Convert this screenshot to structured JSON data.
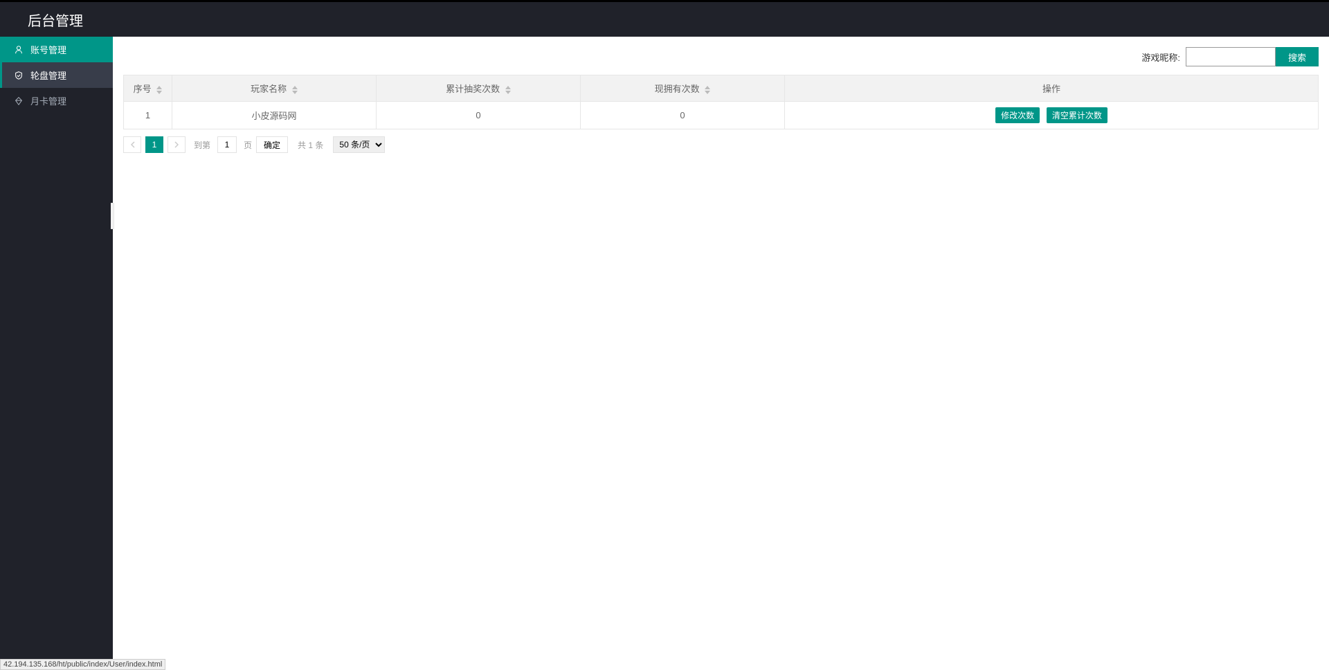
{
  "header": {
    "title": "后台管理"
  },
  "sidebar": {
    "items": [
      {
        "label": "账号管理",
        "icon": "user"
      },
      {
        "label": "轮盘管理",
        "icon": "shield"
      },
      {
        "label": "月卡管理",
        "icon": "diamond"
      }
    ]
  },
  "search": {
    "label": "游戏昵称:",
    "value": "",
    "button": "搜索"
  },
  "table": {
    "headers": {
      "seq": "序号",
      "name": "玩家名称",
      "drawCount": "累计抽奖次数",
      "ownCount": "现拥有次数",
      "action": "操作"
    },
    "rows": [
      {
        "seq": "1",
        "name": "小皮源码网",
        "drawCount": "0",
        "ownCount": "0"
      }
    ],
    "actions": {
      "modify": "修改次数",
      "clear": "清空累计次数"
    }
  },
  "pagination": {
    "current": "1",
    "goToLabel": "到第",
    "goToValue": "1",
    "pageLabel": "页",
    "confirm": "确定",
    "total": "共 1 条",
    "perPage": "50 条/页"
  },
  "statusBar": "42.194.135.168/ht/public/index/User/index.html"
}
